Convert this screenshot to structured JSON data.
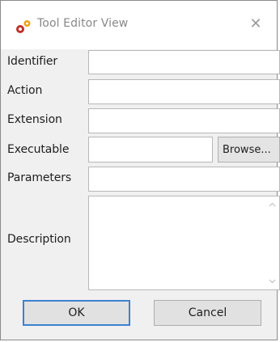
{
  "window": {
    "title": "Tool Editor View",
    "close_glyph": "✕",
    "icon": "gears-icon"
  },
  "form": {
    "identifier": {
      "label": "Identifier",
      "value": ""
    },
    "action": {
      "label": "Action",
      "value": ""
    },
    "extension": {
      "label": "Extension",
      "value": ""
    },
    "executable": {
      "label": "Executable",
      "value": "",
      "browse_label": "Browse..."
    },
    "parameters": {
      "label": "Parameters",
      "value": ""
    },
    "description": {
      "label": "Description",
      "value": ""
    }
  },
  "buttons": {
    "ok_label": "OK",
    "cancel_label": "Cancel"
  },
  "colors": {
    "default_button_border": "#3c82d2",
    "icon_orange": "#e8a21a",
    "icon_red": "#c0302a"
  }
}
